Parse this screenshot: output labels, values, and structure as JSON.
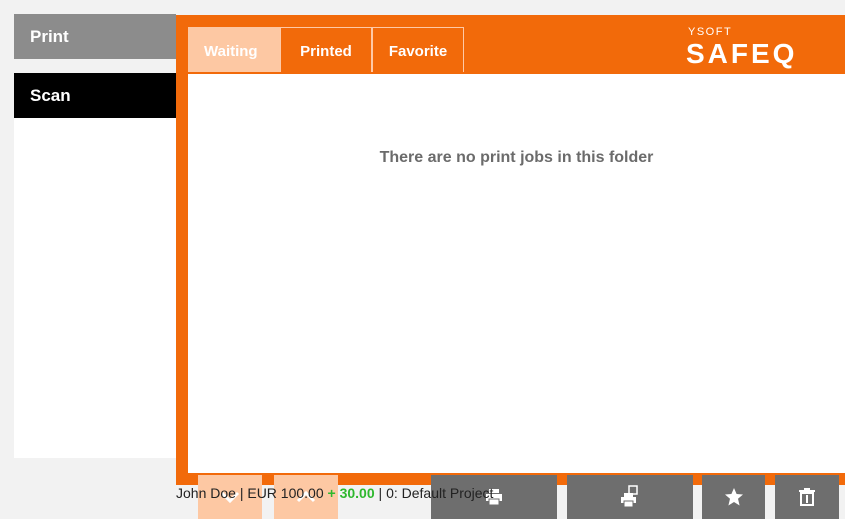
{
  "sidebar": {
    "items": [
      {
        "label": "Print"
      },
      {
        "label": "Scan"
      }
    ]
  },
  "tabs": [
    {
      "label": "Waiting",
      "active": true
    },
    {
      "label": "Printed"
    },
    {
      "label": "Favorite"
    }
  ],
  "logo": {
    "top": "YSOFT",
    "main": "SAFEQ"
  },
  "main": {
    "empty_message": "There are no print jobs in this folder"
  },
  "actions": {
    "scroll_down": "chevron-down-icon",
    "scroll_up": "chevron-up-icon",
    "print": "printer-icon",
    "print_copy": "print-copy-icon",
    "favorite": "star-icon",
    "delete": "trash-icon"
  },
  "footer": {
    "user": "John Doe",
    "sep1": " | ",
    "balance": "EUR 100.00",
    "plus": "+ 30.00",
    "sep2": " | ",
    "project": "0: Default Project"
  },
  "colors": {
    "accent": "#f26a0a",
    "accent_light": "#fdc8a3",
    "button_dark": "#6e6e6e",
    "positive": "#2eb82e"
  }
}
